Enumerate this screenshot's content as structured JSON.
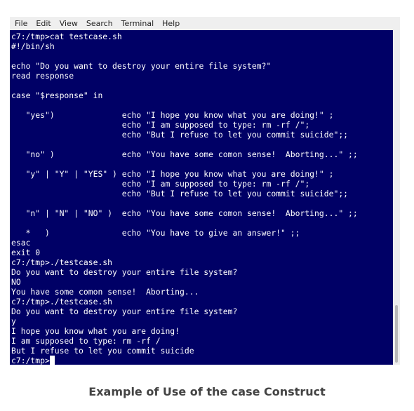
{
  "menu": {
    "items": [
      {
        "label": "File"
      },
      {
        "label": "Edit"
      },
      {
        "label": "View"
      },
      {
        "label": "Search"
      },
      {
        "label": "Terminal"
      },
      {
        "label": "Help"
      }
    ]
  },
  "terminal": {
    "lines": [
      "c7:/tmp>cat testcase.sh",
      "#!/bin/sh",
      "",
      "echo \"Do you want to destroy your entire file system?\"",
      "read response",
      "",
      "case \"$response\" in",
      "",
      "   \"yes\")              echo \"I hope you know what you are doing!\" ;",
      "                       echo \"I am supposed to type: rm -rf /\";",
      "                       echo \"But I refuse to let you commit suicide\";;",
      "",
      "   \"no\" )              echo \"You have some comon sense!  Aborting...\" ;;",
      "",
      "   \"y\" | \"Y\" | \"YES\" ) echo \"I hope you know what you are doing!\" ;",
      "                       echo \"I am supposed to type: rm -rf /\";",
      "                       echo \"But I refuse to let you commit suicide\";;",
      "",
      "   \"n\" | \"N\" | \"NO\" )  echo \"You have some comon sense!  Aborting...\" ;;",
      "",
      "   *   )               echo \"You have to give an answer!\" ;;",
      "esac",
      "exit 0",
      "c7:/tmp>./testcase.sh",
      "Do you want to destroy your entire file system?",
      "NO",
      "You have some comon sense!  Aborting...",
      "c7:/tmp>./testcase.sh",
      "Do you want to destroy your entire file system?",
      "y",
      "I hope you know what you are doing!",
      "I am supposed to type: rm -rf /",
      "But I refuse to let you commit suicide"
    ],
    "prompt": "c7:/tmp>"
  },
  "caption": "Example of Use of the case Construct",
  "colors": {
    "terminal_bg": "#000066",
    "terminal_fg": "#ffffff",
    "menubar_bg": "#efefef"
  }
}
